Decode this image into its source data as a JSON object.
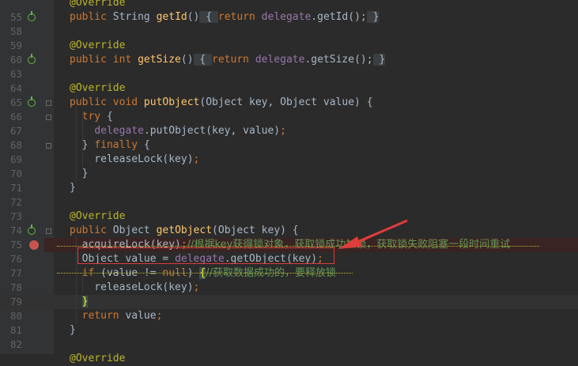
{
  "lines": [
    {
      "num": "",
      "tokens": [
        {
          "c": "ann",
          "t": "@Override"
        }
      ],
      "marker": false
    },
    {
      "num": "55",
      "tokens": [
        {
          "c": "kw",
          "t": "public "
        },
        {
          "c": "",
          "t": "String "
        },
        {
          "c": "fn",
          "t": "getId"
        },
        {
          "c": "",
          "t": "()"
        },
        {
          "c": "fold-box",
          "t": " { "
        },
        {
          "c": "kw",
          "t": "return "
        },
        {
          "c": "field",
          "t": "delegate"
        },
        {
          "c": "",
          "t": ".getId();"
        },
        {
          "c": "fold-box",
          "t": " }"
        }
      ],
      "marker": true
    },
    {
      "num": "58",
      "tokens": [],
      "marker": false
    },
    {
      "num": "59",
      "tokens": [
        {
          "c": "ann",
          "t": "@Override"
        }
      ],
      "marker": false
    },
    {
      "num": "60",
      "tokens": [
        {
          "c": "kw",
          "t": "public int "
        },
        {
          "c": "fn",
          "t": "getSize"
        },
        {
          "c": "",
          "t": "()"
        },
        {
          "c": "fold-box",
          "t": " { "
        },
        {
          "c": "kw",
          "t": "return "
        },
        {
          "c": "field",
          "t": "delegate"
        },
        {
          "c": "",
          "t": ".getSize();"
        },
        {
          "c": "fold-box",
          "t": " }"
        }
      ],
      "marker": true
    },
    {
      "num": "63",
      "tokens": [],
      "marker": false
    },
    {
      "num": "64",
      "tokens": [
        {
          "c": "ann",
          "t": "@Override"
        }
      ],
      "marker": false
    },
    {
      "num": "65",
      "tokens": [
        {
          "c": "kw",
          "t": "public void "
        },
        {
          "c": "fn",
          "t": "putObject"
        },
        {
          "c": "",
          "t": "(Object key, Object value) {"
        }
      ],
      "marker": true
    },
    {
      "num": "66",
      "tokens": [
        {
          "c": "",
          "t": "  "
        },
        {
          "c": "kw",
          "t": "try "
        },
        {
          "c": "",
          "t": "{"
        }
      ],
      "marker": false
    },
    {
      "num": "67",
      "tokens": [
        {
          "c": "",
          "t": "    "
        },
        {
          "c": "field",
          "t": "delegate"
        },
        {
          "c": "",
          "t": ".putObject(key, value)"
        },
        {
          "c": "kw",
          "t": ";"
        }
      ],
      "marker": false
    },
    {
      "num": "68",
      "tokens": [
        {
          "c": "",
          "t": "  } "
        },
        {
          "c": "kw",
          "t": "finally "
        },
        {
          "c": "",
          "t": "{"
        }
      ],
      "marker": false
    },
    {
      "num": "69",
      "tokens": [
        {
          "c": "",
          "t": "    releaseLock(key)"
        },
        {
          "c": "kw",
          "t": ";"
        }
      ],
      "marker": false
    },
    {
      "num": "70",
      "tokens": [
        {
          "c": "",
          "t": "  }"
        }
      ],
      "marker": false
    },
    {
      "num": "71",
      "tokens": [
        {
          "c": "",
          "t": "}"
        }
      ],
      "marker": false
    },
    {
      "num": "72",
      "tokens": [],
      "marker": false
    },
    {
      "num": "73",
      "tokens": [
        {
          "c": "ann",
          "t": "@Override"
        }
      ],
      "marker": false
    },
    {
      "num": "74",
      "tokens": [
        {
          "c": "kw",
          "t": "public "
        },
        {
          "c": "",
          "t": "Object "
        },
        {
          "c": "fn",
          "t": "getObject"
        },
        {
          "c": "",
          "t": "(Object key) {"
        }
      ],
      "marker": true
    },
    {
      "num": "75",
      "tokens": [
        {
          "c": "",
          "t": "  acquireLock(key)"
        },
        {
          "c": "kw",
          "t": ";"
        },
        {
          "c": "cmt",
          "t": "//根据key获得锁对象，获取锁成功加锁，获取锁失败阻塞一段时间重试"
        }
      ],
      "marker": false
    },
    {
      "num": "76",
      "tokens": [
        {
          "c": "",
          "t": "  Object value = "
        },
        {
          "c": "field",
          "t": "delegate"
        },
        {
          "c": "",
          "t": ".getObject(key)"
        },
        {
          "c": "kw",
          "t": ";"
        }
      ],
      "marker": false
    },
    {
      "num": "77",
      "tokens": [
        {
          "c": "",
          "t": "  "
        },
        {
          "c": "kw",
          "t": "if "
        },
        {
          "c": "",
          "t": "(value != "
        },
        {
          "c": "kw",
          "t": "null"
        },
        {
          "c": "",
          "t": ") "
        },
        {
          "c": "brace-hl",
          "t": "{"
        },
        {
          "c": "cmt",
          "t": "//获取数据成功的，要释放锁"
        }
      ],
      "marker": false
    },
    {
      "num": "78",
      "tokens": [
        {
          "c": "",
          "t": "    releaseLock(key)"
        },
        {
          "c": "kw",
          "t": ";"
        }
      ],
      "marker": false
    },
    {
      "num": "79",
      "tokens": [
        {
          "c": "",
          "t": "  "
        },
        {
          "c": "brace-hl",
          "t": "}"
        }
      ],
      "marker": false
    },
    {
      "num": "80",
      "tokens": [
        {
          "c": "",
          "t": "  "
        },
        {
          "c": "kw",
          "t": "return "
        },
        {
          "c": "",
          "t": "value"
        },
        {
          "c": "kw",
          "t": ";"
        }
      ],
      "marker": false
    },
    {
      "num": "81",
      "tokens": [
        {
          "c": "",
          "t": "}"
        }
      ],
      "marker": false
    },
    {
      "num": "82",
      "tokens": [],
      "marker": false
    },
    {
      "num": "",
      "tokens": [
        {
          "c": "ann",
          "t": "@Override"
        }
      ],
      "marker": false
    }
  ],
  "breakpoint_line": "75",
  "current_line": "79",
  "colors": {
    "background": "#2b2b2b",
    "gutter": "#313335",
    "keyword": "#cc7832",
    "function": "#ffc66d",
    "field": "#9876aa",
    "annotation": "#bbb529",
    "comment": "#629755",
    "annotation_box": "#e03c3c"
  },
  "icons": [
    "override-marker-icon",
    "breakpoint-icon",
    "fold-icon",
    "red-arrow-icon"
  ]
}
